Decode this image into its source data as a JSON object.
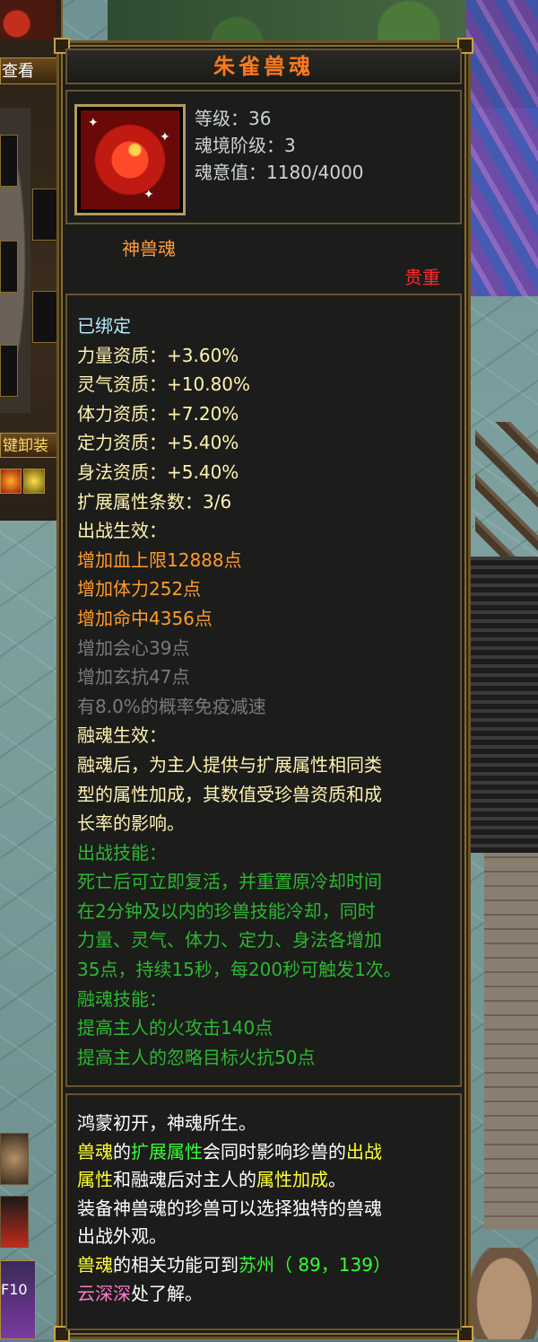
{
  "left_panel": {
    "view_label": "查看",
    "unequip_label": "键卸装",
    "hotkey_label": "F10"
  },
  "tooltip": {
    "title": "朱雀兽魂",
    "stats": {
      "level": "等级：36",
      "realm": "魂境阶级：3",
      "soul_value": "魂意值：1180/4000"
    },
    "kind": "神兽魂",
    "rarity": "贵重",
    "bound": "已绑定",
    "aptitudes": [
      "力量资质：+3.60%",
      "灵气资质：+10.80%",
      "体力资质：+7.20%",
      "定力资质：+5.40%",
      "身法资质：+5.40%"
    ],
    "ext_count": "扩展属性条数：3/6",
    "battle_effect_header": "出战生效：",
    "battle_effects_active": [
      "增加血上限12888点",
      "增加体力252点",
      "增加命中4356点"
    ],
    "battle_effects_inactive": [
      "增加会心39点",
      "增加玄抗47点",
      "有8.0%的概率免疫减速"
    ],
    "fusion_effect_header": "融魂生效：",
    "fusion_effect_text": "融魂后，为主人提供与扩展属性相同类\n型的属性加成，其数值受珍兽资质和成\n长率的影响。",
    "battle_skill_header": "出战技能：",
    "battle_skill_text": "死亡后可立即复活，并重置原冷却时间\n在2分钟及以内的珍兽技能冷却，同时\n力量、灵气、体力、定力、身法各增加\n35点，持续15秒，每200秒可触发1次。",
    "fusion_skill_header": "融魂技能：",
    "fusion_skills": [
      "提高主人的火攻击140点",
      "提高主人的忽略目标火抗50点"
    ],
    "description": {
      "line1": "鸿蒙初开，神魂所生。",
      "line2_a": "兽魂",
      "line2_b": "的",
      "line2_c": "扩展属性",
      "line2_d": "会同时影响珍兽的",
      "line2_e": "出战",
      "line3_a": "属性",
      "line3_b": "和融魂后对主人的",
      "line3_c": "属性加成",
      "line3_d": "。",
      "line4": "装备神兽魂的珍兽可以选择独特的兽魂",
      "line5": "出战外观。",
      "line6_a": "兽魂",
      "line6_b": "的相关功能可到",
      "line6_c": "苏州（ 89，139）",
      "line7_a": "云深深",
      "line7_b": "处了解。"
    }
  },
  "colors": {
    "title": "#ff7a1a",
    "rarity": "#ff2a2a",
    "active_effect": "#ff9c2a",
    "inactive_effect": "#7a7a78",
    "skill_text": "#2bb830",
    "highlight_yellow": "#ffff33",
    "highlight_green": "#33ff33",
    "npc_pink": "#ff7acd",
    "frame": "#6a542a"
  },
  "icons": {
    "item_icon": "vermilion-bird-phoenix-icon"
  }
}
